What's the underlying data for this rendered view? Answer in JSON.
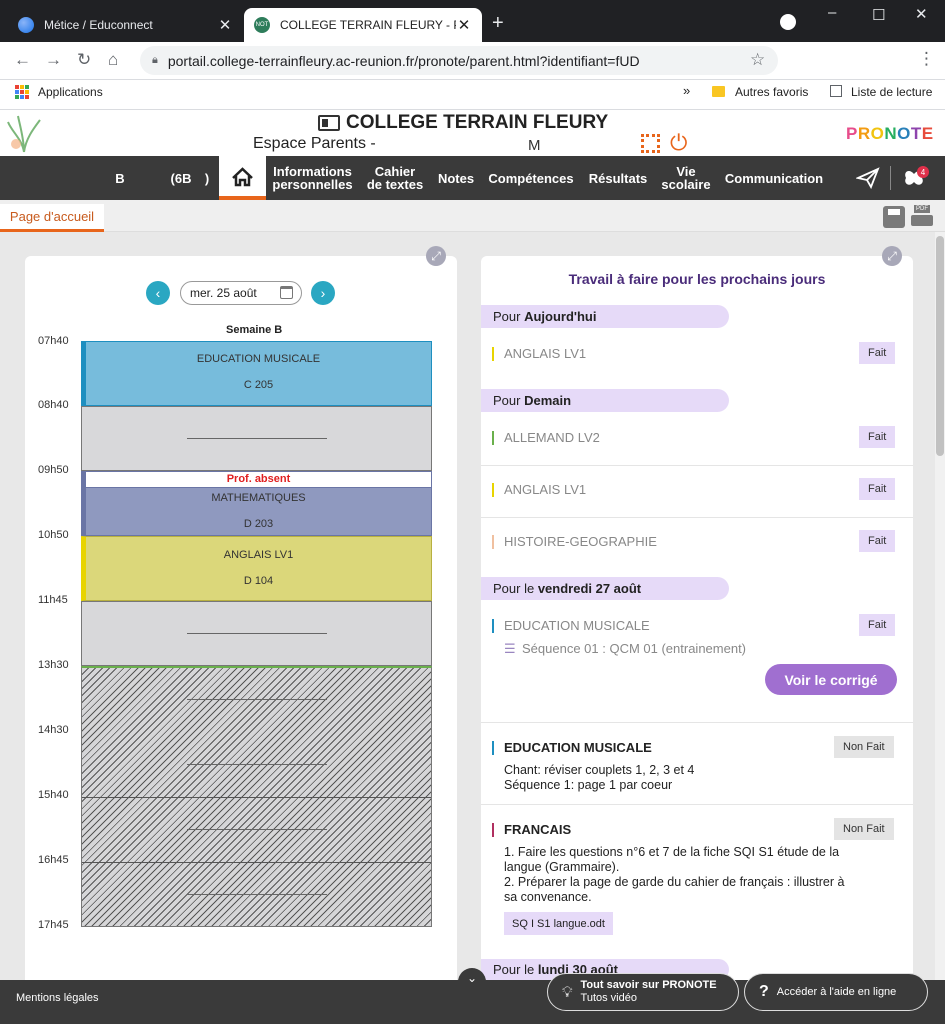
{
  "browser": {
    "tabs": [
      {
        "title": "Métice / Educonnect",
        "close": "✕"
      },
      {
        "title": "COLLEGE TERRAIN FLEURY - PRO",
        "close": "✕"
      }
    ],
    "new_tab": "+",
    "url": "portail.college-terrainfleury.ac-reunion.fr/pronote/parent.html?identifiant=fUD",
    "bookmarks": {
      "apps": "Applications",
      "more": "»",
      "other": "Autres favoris",
      "reading": "Liste de lecture"
    }
  },
  "header": {
    "school": "COLLEGE TERRAIN FLEURY",
    "espace": "Espace Parents -",
    "user_initial": "M",
    "brand": "PRONOTE"
  },
  "menu": {
    "student": "B",
    "class": "(6B",
    "class_close": ")",
    "items": [
      {
        "l1": "Informations",
        "l2": "personnelles"
      },
      {
        "l1": "Cahier",
        "l2": "de textes"
      },
      {
        "l1": "Notes",
        "l2": ""
      },
      {
        "l1": "Compétences",
        "l2": ""
      },
      {
        "l1": "Résultats",
        "l2": ""
      },
      {
        "l1": "Vie",
        "l2": "scolaire"
      },
      {
        "l1": "Communication",
        "l2": ""
      }
    ],
    "notif_count": "4"
  },
  "page_tab": "Page d'accueil",
  "calendar": {
    "date": "mer. 25 août",
    "week": "Semaine B",
    "times": [
      "07h40",
      "08h40",
      "09h50",
      "10h50",
      "11h45",
      "13h30",
      "14h30",
      "15h40",
      "16h45",
      "17h45"
    ],
    "lessons": [
      {
        "subject": "EDUCATION MUSICALE",
        "room": "C 205",
        "color": "#77bcdc",
        "bar": "#1e8fc0"
      },
      {
        "subject": "MATHEMATIQUES",
        "room": "D 203",
        "color": "#8f99bf",
        "bar": "#6a75a5",
        "status": "Prof. absent"
      },
      {
        "subject": "ANGLAIS LV1",
        "room": "D 104",
        "color": "#dbd77a",
        "bar": "#e8d400"
      }
    ]
  },
  "homework": {
    "title": "Travail à faire pour les prochains jours",
    "groups": [
      {
        "prefix": "Pour ",
        "day": "Aujourd'hui"
      },
      {
        "prefix": "Pour ",
        "day": "Demain"
      },
      {
        "prefix": "Pour le ",
        "day": "vendredi 27 août"
      },
      {
        "prefix": "Pour le ",
        "day": "lundi 30 août"
      }
    ],
    "items": [
      {
        "subject": "ANGLAIS LV1",
        "status": "Fait",
        "color": "#e8d400"
      },
      {
        "subject": "ALLEMAND LV2",
        "status": "Fait",
        "color": "#6ab04c"
      },
      {
        "subject": "ANGLAIS LV1",
        "status": "Fait",
        "color": "#e8d400"
      },
      {
        "subject": "HISTOIRE-GEOGRAPHIE",
        "status": "Fait",
        "color": "#f0c0a0"
      },
      {
        "subject": "EDUCATION MUSICALE",
        "status": "Fait",
        "color": "#1e8fc0",
        "sub": "Séquence 01 : QCM 01 (entrainement)",
        "button": "Voir le corrigé"
      },
      {
        "subject": "EDUCATION MUSICALE",
        "status": "Non Fait",
        "color": "#1e8fc0",
        "lines": [
          "Chant: réviser couplets 1, 2, 3 et 4",
          "Séquence 1: page 1 par coeur"
        ]
      },
      {
        "subject": "FRANCAIS",
        "status": "Non Fait",
        "color": "#b03060",
        "lines": [
          "1. Faire les questions n°6 et 7 de la fiche SQI S1 étude de la",
          "langue (Grammaire).",
          "2. Préparer la page de garde du cahier de français : illustrer à",
          "sa convenance."
        ],
        "attachment": "SQ I S1 langue.odt"
      }
    ]
  },
  "footer": {
    "legal": "Mentions légales",
    "tout_savoir": "Tout savoir sur PRONOTE",
    "tutos": "Tutos vidéo",
    "aide": "Accéder à l'aide en ligne"
  },
  "colors": {
    "accent": "#e8651b",
    "menu": "#3a3a3a",
    "lilac": "#e6daf8",
    "button": "#a06fd0",
    "teal": "#2aa7c2"
  }
}
